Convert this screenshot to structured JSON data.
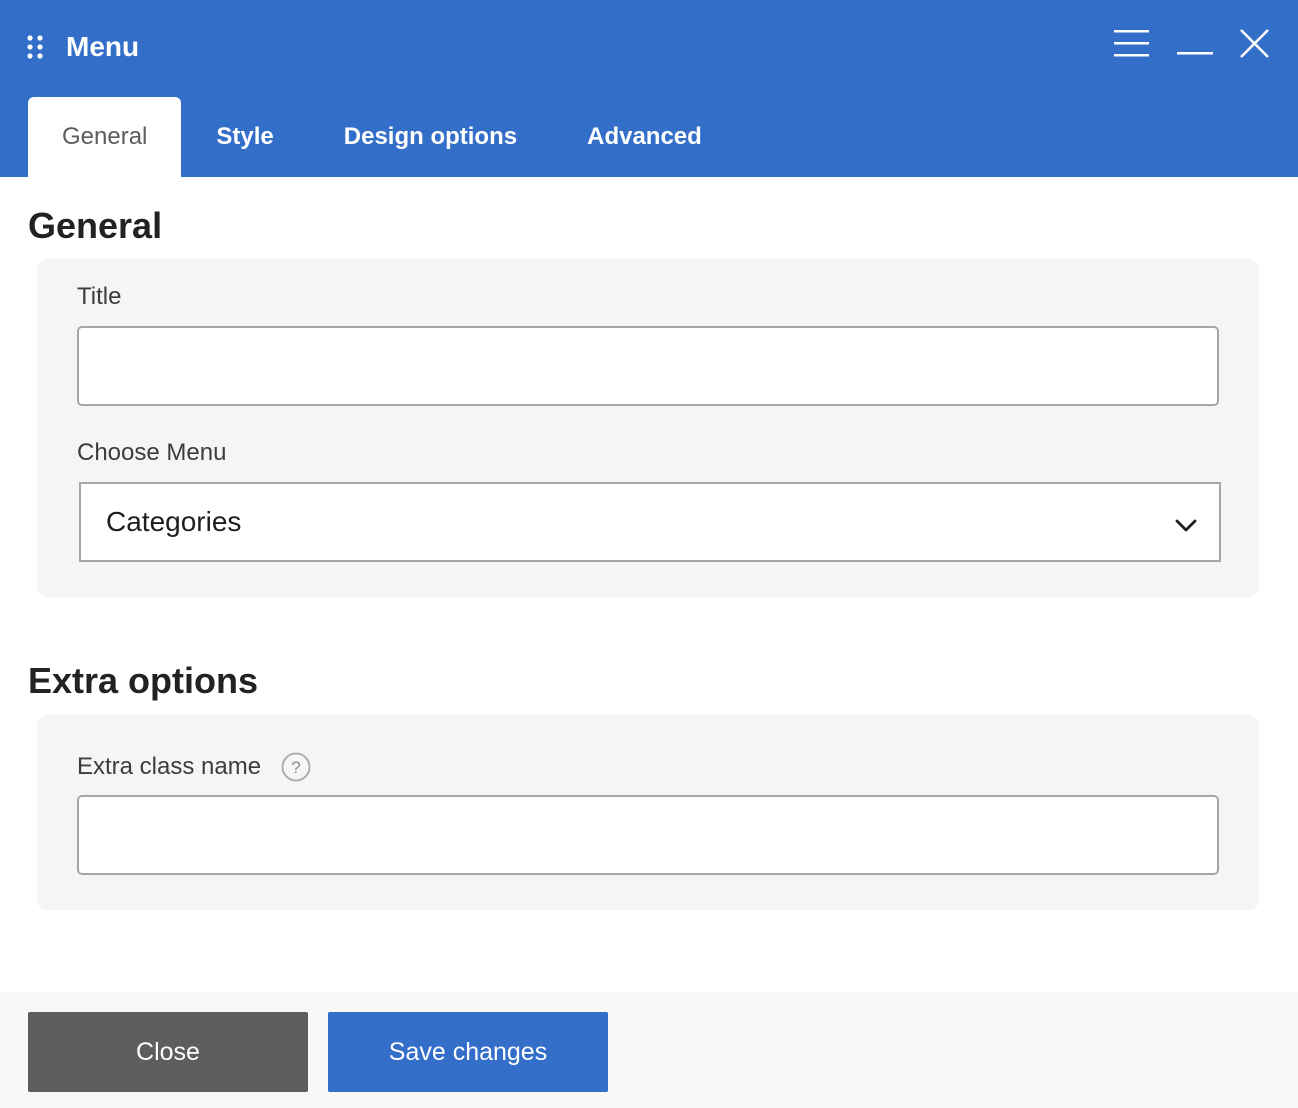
{
  "window": {
    "title": "Menu"
  },
  "tabs": [
    {
      "label": "General",
      "active": true
    },
    {
      "label": "Style",
      "active": false
    },
    {
      "label": "Design options",
      "active": false
    },
    {
      "label": "Advanced",
      "active": false
    }
  ],
  "general": {
    "heading": "General",
    "title_label": "Title",
    "title_value": "",
    "choose_menu_label": "Choose Menu",
    "choose_menu_value": "Categories"
  },
  "extra": {
    "heading": "Extra options",
    "class_label": "Extra class name",
    "class_value": ""
  },
  "footer": {
    "close_label": "Close",
    "save_label": "Save changes"
  },
  "icons": {
    "drag": "drag-handle-icon",
    "menu": "hamburger-icon",
    "minimize": "minimize-icon",
    "close": "close-icon",
    "dropdown": "chevron-down-icon",
    "help": "help-icon"
  },
  "colors": {
    "accent": "#336ec8",
    "close_button": "#5e5e5e",
    "panel_bg": "#f5f5f5"
  }
}
